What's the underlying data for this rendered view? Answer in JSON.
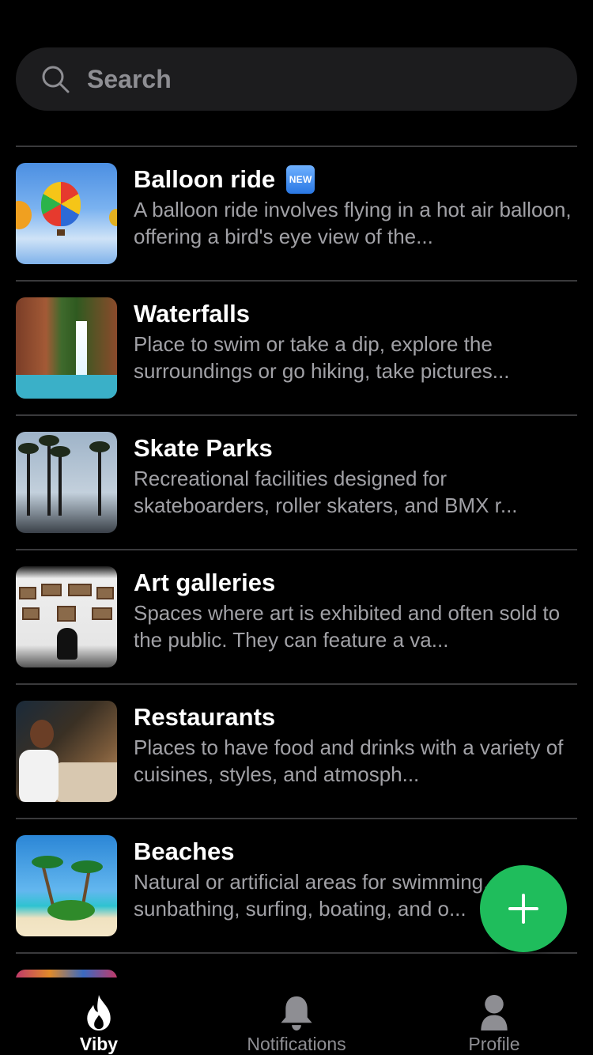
{
  "search": {
    "placeholder": "Search",
    "icon": "search-icon"
  },
  "items": [
    {
      "title": "Balloon ride",
      "badge": "NEW",
      "description": "A balloon ride involves flying in a hot air balloon, offering a bird's eye view of the...",
      "thumbnail": "hot-air-balloons-photo"
    },
    {
      "title": "Waterfalls",
      "description": "Place to swim or take a dip, explore the surroundings or go hiking, take pictures...",
      "thumbnail": "waterfall-photo"
    },
    {
      "title": "Skate Parks",
      "description": "Recreational facilities designed for skateboarders, roller skaters, and BMX r...",
      "thumbnail": "skate-park-palm-trees-photo"
    },
    {
      "title": "Art galleries",
      "description": "Spaces where art is exhibited and often sold to the public. They can feature a va...",
      "thumbnail": "art-gallery-photo"
    },
    {
      "title": "Restaurants",
      "description": "Places to have food and drinks with a variety of cuisines, styles, and atmosph...",
      "thumbnail": "restaurant-diners-photo"
    },
    {
      "title": "Beaches",
      "description": "Natural or artificial areas for swimming, sunbathing, surfing, boating, and o...",
      "thumbnail": "tropical-beach-photo"
    },
    {
      "title": "",
      "description": "",
      "thumbnail": "partial-photo"
    }
  ],
  "fab": {
    "icon": "plus-icon"
  },
  "tabs": [
    {
      "label": "Viby",
      "icon": "flame-icon",
      "active": true
    },
    {
      "label": "Notifications",
      "icon": "bell-icon",
      "active": false
    },
    {
      "label": "Profile",
      "icon": "person-icon",
      "active": false
    }
  ],
  "colors": {
    "background": "#000000",
    "accent": "#1fbd5c",
    "search_bg": "#1c1c1e",
    "secondary_text": "#a1a1a6",
    "divider": "#3a3a3c"
  }
}
